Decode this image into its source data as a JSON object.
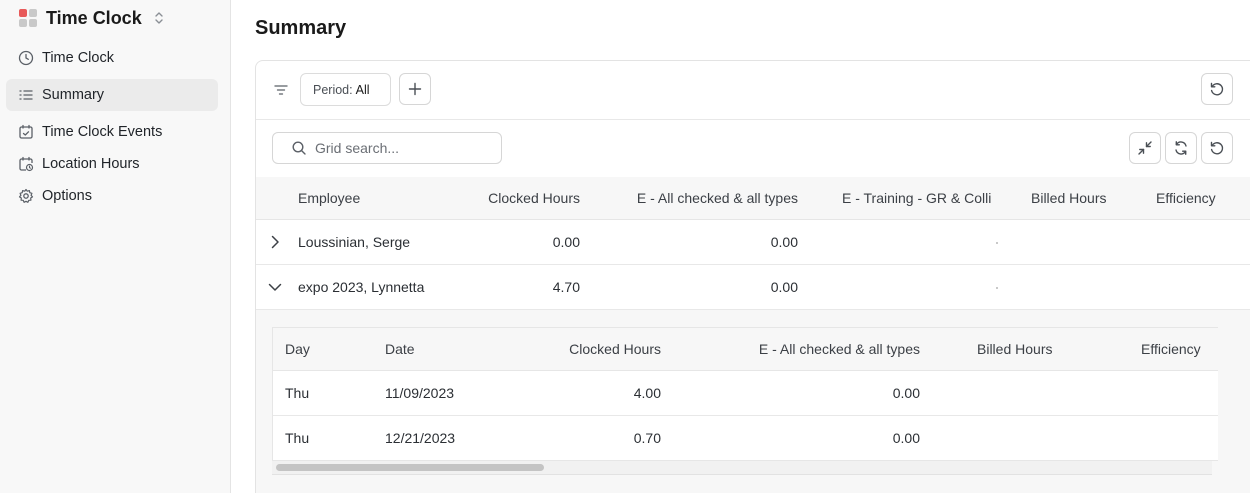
{
  "app": {
    "title": "Time Clock",
    "logo_colors": [
      "#e85a5a",
      "#c9c9c9",
      "#c9c9c9",
      "#c9c9c9"
    ]
  },
  "sidebar": {
    "items": [
      {
        "label": "Time Clock",
        "icon": "clock-icon",
        "active": false
      },
      {
        "label": "Summary",
        "icon": "list-icon",
        "active": true
      },
      {
        "label": "Time Clock Events",
        "icon": "calendar-check-icon",
        "active": false
      },
      {
        "label": "Location Hours",
        "icon": "calendar-clock-icon",
        "active": false
      },
      {
        "label": "Options",
        "icon": "gear-icon",
        "active": false
      }
    ]
  },
  "page": {
    "title": "Summary"
  },
  "toolbar": {
    "period_key": "Period:",
    "period_value": "All"
  },
  "search": {
    "placeholder": "Grid search..."
  },
  "grid": {
    "columns": [
      "Employee",
      "Clocked Hours",
      "E - All checked & all types",
      "E - Training - GR & Colli",
      "Billed Hours",
      "Efficiency"
    ],
    "rows": [
      {
        "expanded": false,
        "employee": "Loussinian, Serge",
        "clocked": "0.00",
        "all_checked": "0.00"
      },
      {
        "expanded": true,
        "employee": "expo 2023, Lynnetta",
        "clocked": "4.70",
        "all_checked": "0.00"
      }
    ]
  },
  "detail": {
    "columns": [
      "Day",
      "Date",
      "Clocked Hours",
      "E - All checked & all types",
      "Billed Hours",
      "Efficiency"
    ],
    "rows": [
      {
        "day": "Thu",
        "date": "11/09/2023",
        "clocked": "4.00",
        "all_checked": "0.00"
      },
      {
        "day": "Thu",
        "date": "12/21/2023",
        "clocked": "0.70",
        "all_checked": "0.00"
      }
    ],
    "scroll_fraction": 0.28
  }
}
